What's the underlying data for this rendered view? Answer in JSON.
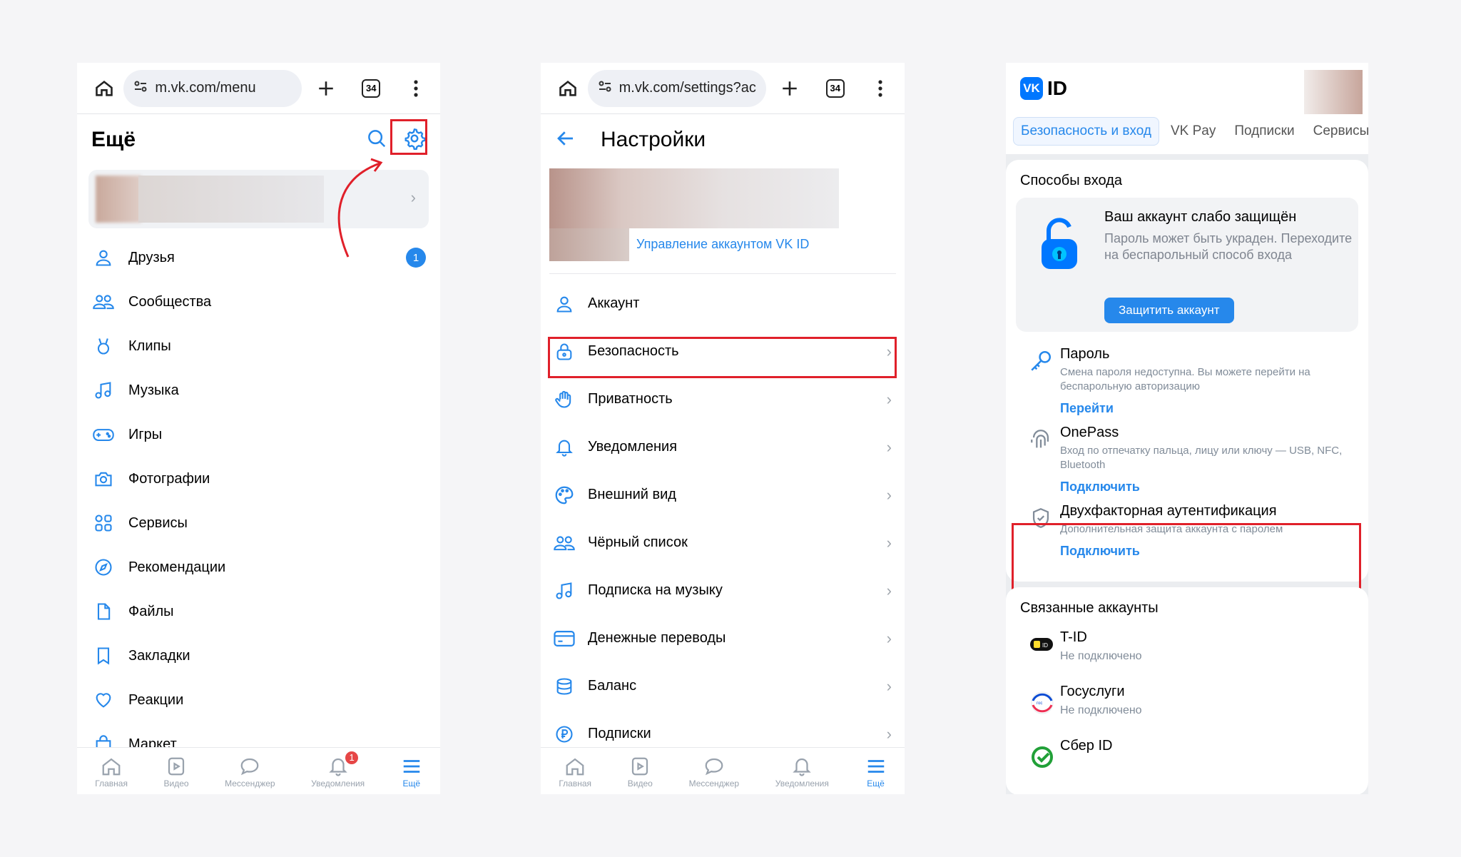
{
  "colors": {
    "accent": "#2688eb",
    "highlight": "#e0202a",
    "badge": "#e64646"
  },
  "panel1": {
    "url": "m.vk.com/menu",
    "tabs_count": "34",
    "title": "Ещё",
    "menu": [
      {
        "label": "Друзья",
        "icon": "user-icon",
        "badge": "1"
      },
      {
        "label": "Сообщества",
        "icon": "users-icon"
      },
      {
        "label": "Клипы",
        "icon": "clips-icon"
      },
      {
        "label": "Музыка",
        "icon": "music-icon"
      },
      {
        "label": "Игры",
        "icon": "gamepad-icon"
      },
      {
        "label": "Фотографии",
        "icon": "camera-icon"
      },
      {
        "label": "Сервисы",
        "icon": "services-icon"
      },
      {
        "label": "Рекомендации",
        "icon": "compass-icon"
      },
      {
        "label": "Файлы",
        "icon": "file-icon"
      },
      {
        "label": "Закладки",
        "icon": "bookmark-icon"
      },
      {
        "label": "Реакции",
        "icon": "heart-icon"
      },
      {
        "label": "Маркет",
        "icon": "bag-icon"
      }
    ],
    "tabbar": [
      {
        "label": "Главная",
        "icon": "home-icon"
      },
      {
        "label": "Видео",
        "icon": "video-icon"
      },
      {
        "label": "Мессенджер",
        "icon": "chat-icon"
      },
      {
        "label": "Уведомления",
        "icon": "bell-icon",
        "badge": "1"
      },
      {
        "label": "Ещё",
        "icon": "menu-icon",
        "active": true
      }
    ]
  },
  "panel2": {
    "url": "m.vk.com/settings?ac",
    "tabs_count": "34",
    "title": "Настройки",
    "manage_link": "Управление аккаунтом VK ID",
    "items": [
      {
        "label": "Аккаунт",
        "icon": "user-icon"
      },
      {
        "label": "Безопасность",
        "icon": "lock-icon"
      },
      {
        "label": "Приватность",
        "icon": "hand-icon"
      },
      {
        "label": "Уведомления",
        "icon": "bell-icon"
      },
      {
        "label": "Внешний вид",
        "icon": "palette-icon"
      },
      {
        "label": "Чёрный список",
        "icon": "users-icon"
      },
      {
        "label": "Подписка на музыку",
        "icon": "music-icon"
      },
      {
        "label": "Денежные переводы",
        "icon": "card-icon"
      },
      {
        "label": "Баланс",
        "icon": "coins-icon"
      },
      {
        "label": "Подписки",
        "icon": "ruble-icon"
      }
    ],
    "tabbar": [
      {
        "label": "Главная"
      },
      {
        "label": "Видео"
      },
      {
        "label": "Мессенджер"
      },
      {
        "label": "Уведомления"
      },
      {
        "label": "Ещё"
      }
    ]
  },
  "panel3": {
    "brand": "ID",
    "brand_logo": "VK",
    "tabs": [
      "Безопасность и вход",
      "VK Pay",
      "Подписки",
      "Сервисы"
    ],
    "login_methods_title": "Способы входа",
    "warning": {
      "title": "Ваш аккаунт слабо защищён",
      "text": "Пароль может быть украден. Переходите на беспарольный способ входа",
      "button": "Защитить аккаунт"
    },
    "password": {
      "title": "Пароль",
      "desc": "Смена пароля недоступна. Вы можете перейти на беспарольную авторизацию",
      "link": "Перейти"
    },
    "onepass": {
      "title": "OnePass",
      "desc": "Вход по отпечатку пальца, лицу или ключу — USB, NFC, Bluetooth",
      "link": "Подключить"
    },
    "twofa": {
      "title": "Двухфакторная аутентификация",
      "desc": "Дополнительная защита аккаунта с паролем",
      "link": "Подключить"
    },
    "linked_title": "Связанные аккаунты",
    "linked": [
      {
        "name": "T-ID",
        "status": "Не подключено"
      },
      {
        "name": "Госуслуги",
        "status": "Не подключено"
      },
      {
        "name": "Сбер ID",
        "status": ""
      }
    ]
  }
}
